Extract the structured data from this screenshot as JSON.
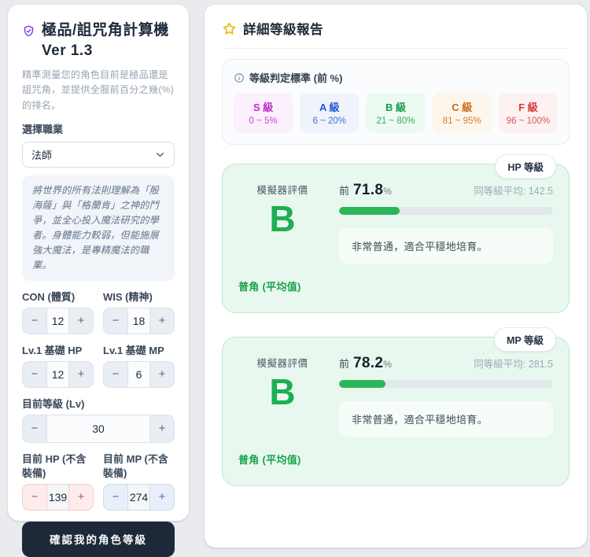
{
  "page": {
    "background": "#e9ebef"
  },
  "calculator": {
    "icon": "shield-check-icon",
    "icon_color": "#7c3aed",
    "title_line1": "極品/詛咒角計算機",
    "title_line2": "Ver 1.3",
    "description": "精準測量您的角色目前是極品還是詛咒角，並提供全服前百分之幾(%)的排名。",
    "job_select": {
      "label": "選擇職業",
      "selected": "法師",
      "chevron": "chevron-down-icon"
    },
    "job_description": "將世界的所有法則理解為「殷海薩」與「格蘭肯」之神的鬥爭，並全心投入魔法研究的學者。身體能力較弱，但能施展強大魔法，是專精魔法的職業。",
    "minus_symbol": "−",
    "plus_symbol": "+",
    "fields": {
      "con": {
        "label": "CON (體質)",
        "value": "12"
      },
      "wis": {
        "label": "WIS (精神)",
        "value": "18"
      },
      "base_hp": {
        "label": "Lv.1 基礎 HP",
        "value": "12"
      },
      "base_mp": {
        "label": "Lv.1 基礎 MP",
        "value": "6"
      },
      "level": {
        "label": "目前等級 (Lv)",
        "value": "30"
      },
      "current_hp": {
        "label": "目前 HP (不含裝備)",
        "value": "139",
        "accent": "#c84a4a"
      },
      "current_mp": {
        "label": "目前 MP (不含裝備)",
        "value": "274",
        "accent": "#4468c8"
      }
    },
    "submit_label": "確認我的角色等級",
    "submit_bg": "#1d2838"
  },
  "report": {
    "icon": "star-icon",
    "icon_color": "#eab308",
    "title": "詳細等級報告",
    "criteria": {
      "icon": "info-icon",
      "title": "等級判定標準 (前 %)",
      "grades": [
        {
          "label": "S 級",
          "range": "0 ~ 5%",
          "color": "#bb2fc9",
          "bg": "#fbf0fc"
        },
        {
          "label": "A 級",
          "range": "6 ~ 20%",
          "color": "#2457d6",
          "bg": "#eef3fc"
        },
        {
          "label": "B 級",
          "range": "21 ~ 80%",
          "color": "#189a4a",
          "bg": "#edfaf2"
        },
        {
          "label": "C 級",
          "range": "81 ~ 95%",
          "color": "#c96a15",
          "bg": "#fdf6ec"
        },
        {
          "label": "F 級",
          "range": "96 ~ 100%",
          "color": "#d23c3c",
          "bg": "#fdf1f1"
        }
      ]
    },
    "cards": [
      {
        "badge": "HP 等級",
        "eval_label": "模擬器評價",
        "grade": "B",
        "grade_color": "#1daf52",
        "percent_prefix": "前",
        "percent_value": "71.8",
        "percent_unit": "%",
        "peer_average": "同等級平均: 142.5",
        "bar_fill_percent": 28.2,
        "bar_color": "#2cb65a",
        "message": "非常普通，適合平穩地培育。",
        "verdict": "普角 (平均值)"
      },
      {
        "badge": "MP 等級",
        "eval_label": "模擬器評價",
        "grade": "B",
        "grade_color": "#1daf52",
        "percent_prefix": "前",
        "percent_value": "78.2",
        "percent_unit": "%",
        "peer_average": "同等級平均: 281.5",
        "bar_fill_percent": 21.8,
        "bar_color": "#2cb65a",
        "message": "非常普通，適合平穩地培育。",
        "verdict": "普角 (平均值)"
      }
    ]
  }
}
